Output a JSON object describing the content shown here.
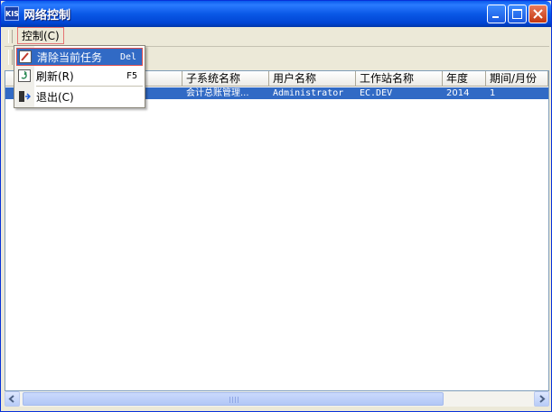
{
  "window": {
    "app_icon_text": "KIS",
    "title": "网络控制"
  },
  "menubar": {
    "control_label": "控制(C)"
  },
  "dropdown": {
    "items": [
      {
        "label": "清除当前任务",
        "shortcut": "Del"
      },
      {
        "label": "刷新(R)",
        "shortcut": "F5"
      },
      {
        "label": "退出(C)",
        "shortcut": ""
      }
    ]
  },
  "table": {
    "columns": [
      "",
      "子系统名称",
      "用户名称",
      "工作站名称",
      "年度",
      "期间/月份"
    ],
    "rows": [
      {
        "col0": "",
        "subsystem": "会计总账管理...",
        "user": "Administrator",
        "workstation": "EC.DEV",
        "year": "2014",
        "period": "1"
      }
    ]
  },
  "colors": {
    "selection": "#316AC5",
    "titlebar": "#0A5BEB",
    "highlight_border": "#E05050"
  },
  "icons": [
    "app-logo-icon",
    "minimize-icon",
    "maximize-icon",
    "close-icon",
    "eraser-icon",
    "refresh-icon",
    "exit-icon",
    "scroll-left-icon",
    "scroll-right-icon"
  ]
}
